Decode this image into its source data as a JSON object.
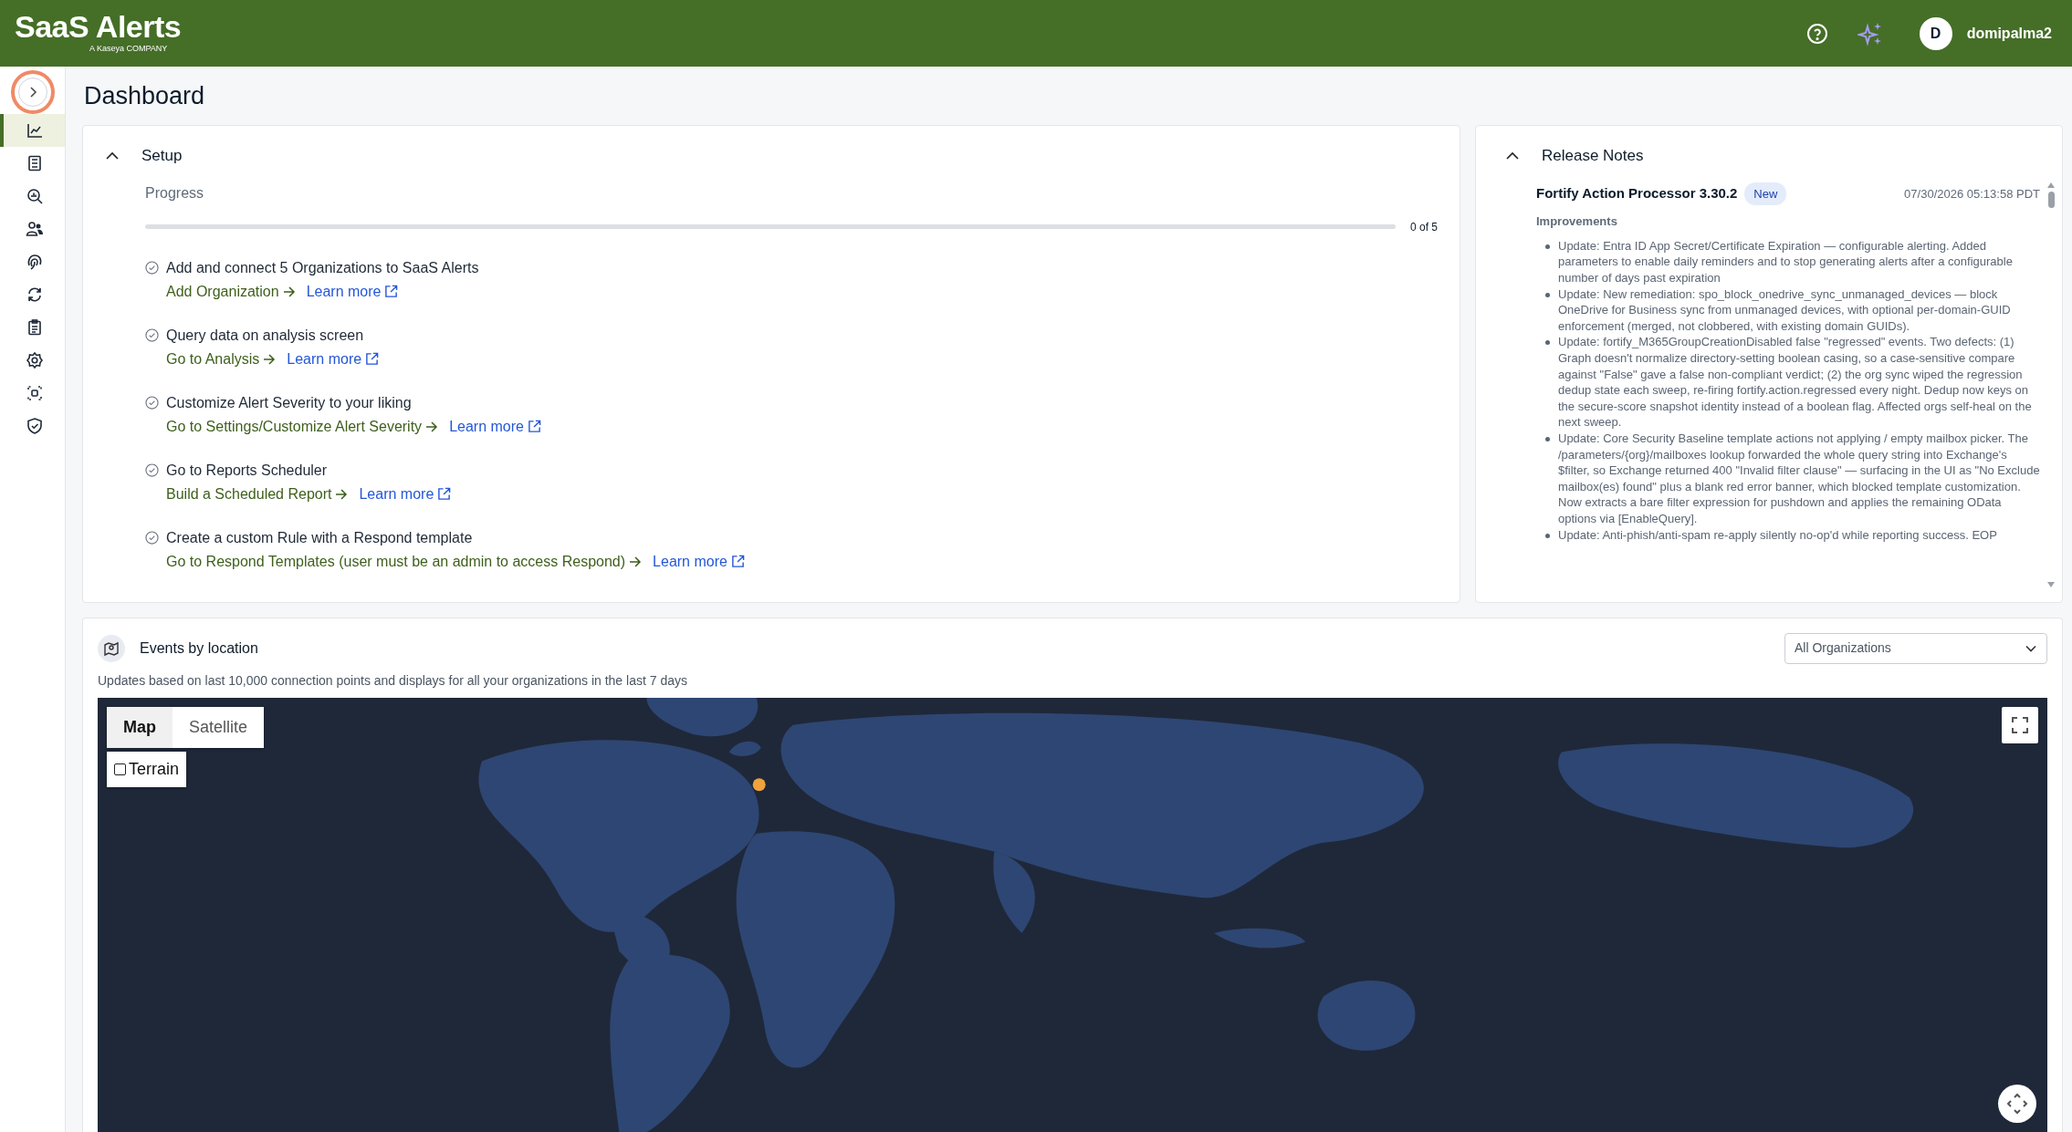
{
  "header": {
    "logo": "SaaS Alerts",
    "tagline": "A Kaseya COMPANY",
    "user": {
      "avatar": "D",
      "name": "domipalma2"
    }
  },
  "sidebar": {
    "items": [
      {
        "selected": true
      },
      {
        "selected": false
      },
      {
        "selected": false
      },
      {
        "selected": false
      },
      {
        "selected": false
      },
      {
        "selected": false
      },
      {
        "selected": false
      },
      {
        "selected": false
      },
      {
        "selected": false
      },
      {
        "selected": false
      }
    ]
  },
  "page_title": "Dashboard",
  "setup": {
    "title": "Setup",
    "expanded": true,
    "progress": {
      "label": "Progress",
      "level": 0,
      "reading": "0 of 5"
    },
    "steps": [
      {
        "text": "Add and connect 5 Organizations to SaaS Alerts",
        "action": "Add Organization",
        "link": "Learn more"
      },
      {
        "text": "Query data on analysis screen",
        "action": "Go to Analysis",
        "link": "Learn more"
      },
      {
        "text": "Customize Alert Severity to your liking",
        "action": "Go to Settings/Customize Alert Severity",
        "link": "Learn more"
      },
      {
        "text": "Go to Reports Scheduler",
        "action": "Build a Scheduled Report",
        "link": "Learn more"
      },
      {
        "text": "Create a custom Rule with a Respond template",
        "action": "Go to Respond Templates (user must be an admin to access Respond)",
        "link": "Learn more"
      }
    ]
  },
  "release_notes": {
    "title": "Release Notes",
    "expanded": true,
    "entry": {
      "title": "Fortify Action Processor 3.30.2",
      "badge": "New",
      "date": "07/30/2026 05:13:58 PDT",
      "section": "Improvements",
      "items": [
        "Update: Entra ID App Secret/Certificate Expiration — configurable alerting. Added parameters to enable daily reminders and to stop generating alerts after a configurable number of days past expiration",
        "Update: New remediation: spo_block_onedrive_sync_unmanaged_devices — block OneDrive for Business sync from unmanaged devices, with optional per-domain-GUID enforcement (merged, not clobbered, with existing domain GUIDs).",
        "Update: fortify_M365GroupCreationDisabled false \"regressed\" events. Two defects: (1) Graph doesn't normalize directory-setting boolean casing, so a case-sensitive compare against \"False\" gave a false non-compliant verdict; (2) the org sync wiped the regression dedup state each sweep, re-firing fortify.action.regressed every night. Dedup now keys on the secure-score snapshot identity instead of a boolean flag. Affected orgs self-heal on the next sweep.",
        "Update: Core Security Baseline template actions not applying / empty mailbox picker. The /parameters/{org}/mailboxes lookup forwarded the whole query string into Exchange's $filter, so Exchange returned 400 \"Invalid filter clause\" — surfacing in the UI as \"No Exclude mailbox(es) found\" plus a blank red error banner, which blocked template customization. Now extracts a bare filter expression for pushdown and applies the remaining OData options via [EnableQuery].",
        "Update: Anti-phish/anti-spam re-apply silently no-op'd while reporting success. EOP"
      ]
    }
  },
  "events": {
    "title": "Events by location",
    "subtitle": "Updates based on last 10,000 connection points and displays for all your organizations in the last 7 days",
    "org_select": {
      "value": "All Organizations"
    },
    "map": {
      "kind": "picture",
      "view_tabs": [
        {
          "label": "Map",
          "selected": true
        },
        {
          "label": "Satellite",
          "selected": false
        }
      ],
      "terrain": {
        "label": "Terrain",
        "checked": false
      }
    }
  }
}
